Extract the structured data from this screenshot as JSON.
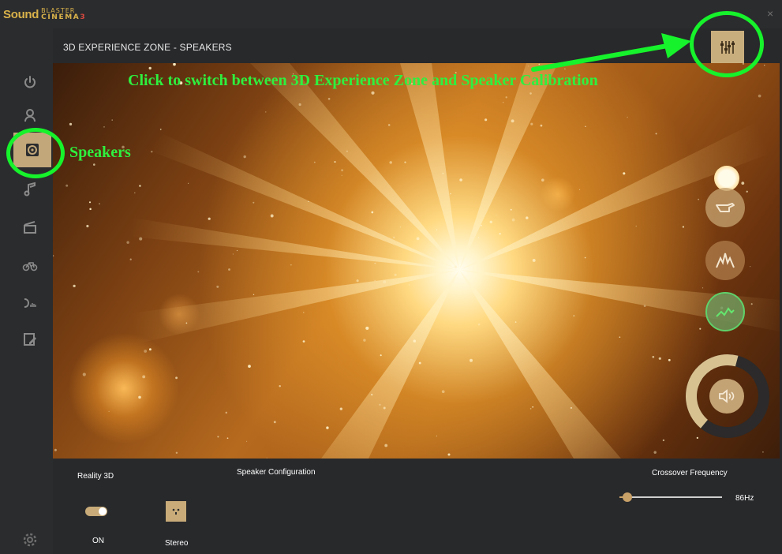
{
  "app": {
    "logo_word": "Sound",
    "logo_top": "BLASTER",
    "logo_bottom": "CINEMA",
    "logo_number": "3",
    "close_glyph": "×"
  },
  "header": {
    "title": "3D EXPERIENCE ZONE - SPEAKERS",
    "toggle_icon": "sliders-icon"
  },
  "sidebar": {
    "items": [
      {
        "id": "power",
        "icon": "power-icon",
        "active": false
      },
      {
        "id": "profile",
        "icon": "user-icon",
        "active": false
      },
      {
        "id": "speakers",
        "icon": "speaker-icon",
        "active": true
      },
      {
        "id": "music",
        "icon": "music-note-icon",
        "active": false
      },
      {
        "id": "movie",
        "icon": "clapperboard-icon",
        "active": false
      },
      {
        "id": "game",
        "icon": "bike-icon",
        "active": false
      },
      {
        "id": "voice",
        "icon": "voice-icon",
        "active": false
      },
      {
        "id": "edit",
        "icon": "edit-icon",
        "active": false
      }
    ],
    "settings_icon": "gear-icon"
  },
  "visual": {
    "controls": [
      {
        "id": "pointer",
        "icon": "pointing-hand-icon"
      },
      {
        "id": "burst",
        "icon": "burst-icon"
      },
      {
        "id": "wave",
        "icon": "waveform-icon",
        "active": true
      }
    ],
    "volume_icon": "speaker-volume-icon",
    "volume_level": 0.55
  },
  "bottom": {
    "reality_label": "Reality 3D",
    "reality_state": "ON",
    "speaker_config_label": "Speaker Configuration",
    "speaker_config_value": "Stereo",
    "crossover_label": "Crossover Frequency",
    "crossover_value": "86Hz",
    "crossover_level": 0.08
  },
  "annotations": {
    "switch_hint": "Click to switch between 3D Experience Zone and Speaker Calibration",
    "speakers_hint": "Speakers"
  },
  "colors": {
    "accent_gold": "#c8ab78",
    "annotation_green": "#16f22b"
  }
}
